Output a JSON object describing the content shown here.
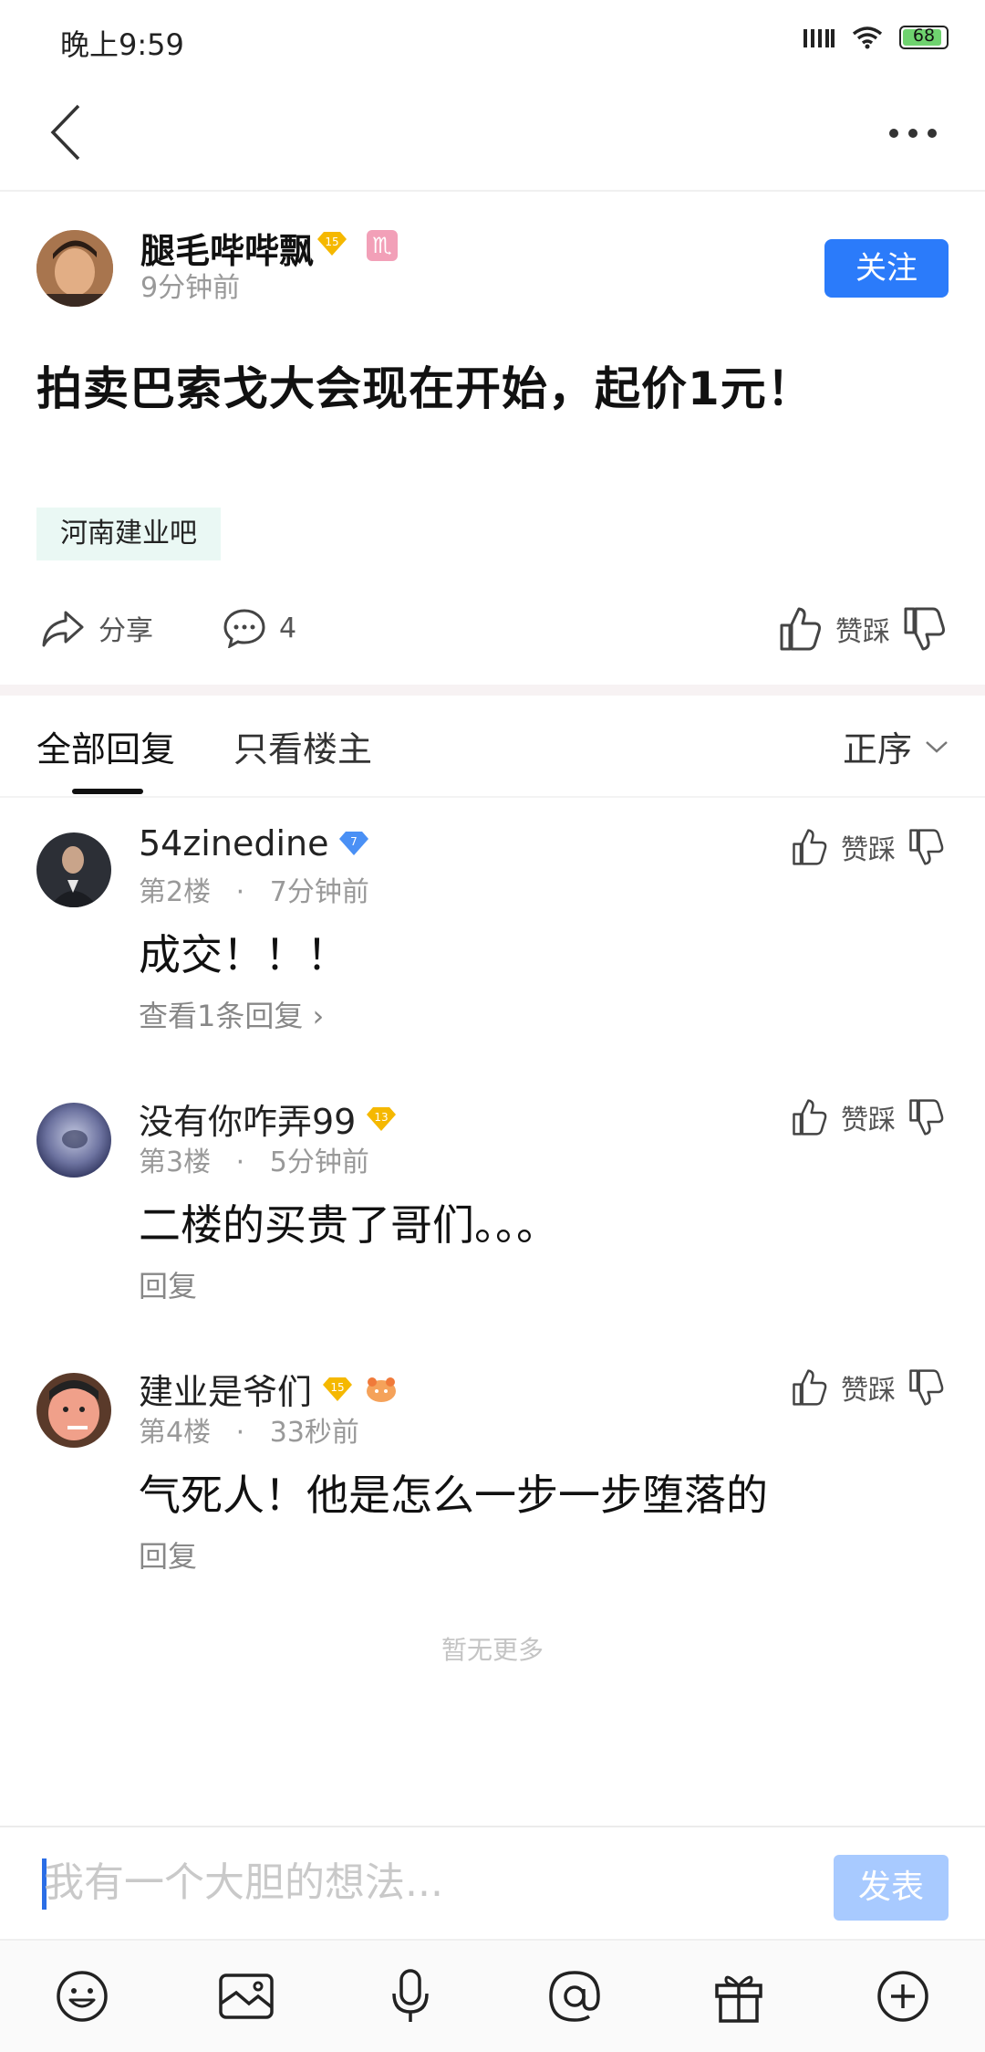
{
  "status_bar": {
    "time": "晚上9:59",
    "battery": "68"
  },
  "post": {
    "author": {
      "name": "腿毛哔哔飘",
      "time": "9分钟前",
      "level": "15",
      "zodiac": "♏"
    },
    "follow_label": "关注",
    "title": "拍卖巴索戈大会现在开始，起价1元！",
    "forum_tag": "河南建业吧",
    "share_label": "分享",
    "comment_count": "4",
    "vote_label": "赞踩"
  },
  "tabs": {
    "all": "全部回复",
    "owner_only": "只看楼主",
    "sort": "正序"
  },
  "comments": [
    {
      "name": "54zinedine",
      "level": "7",
      "floor": "第2楼",
      "time": "7分钟前",
      "text": "成交！！！",
      "reply": "查看1条回复",
      "vote": "赞踩"
    },
    {
      "name": "没有你咋弄99",
      "level": "13",
      "floor": "第3楼",
      "time": "5分钟前",
      "text": "二楼的买贵了哥们。。。",
      "reply": "回复",
      "vote": "赞踩"
    },
    {
      "name": "建业是爷们",
      "level": "15",
      "floor": "第4楼",
      "time": "33秒前",
      "text": "气死人！他是怎么一步一步堕落的",
      "reply": "回复",
      "vote": "赞踩"
    }
  ],
  "footer": {
    "end_text": "暂无更多"
  },
  "composer": {
    "placeholder": "我有一个大胆的想法...",
    "publish_label": "发表"
  },
  "colors": {
    "accent": "#2b7bfa",
    "publish_disabled": "#a8caff",
    "tag_bg": "#eaf8f4",
    "gold_badge": "#f5b800",
    "blue_badge": "#4a90f5"
  },
  "toolbar_icons": [
    "emoji-icon",
    "image-icon",
    "microphone-icon",
    "at-icon",
    "gift-icon",
    "plus-icon"
  ]
}
